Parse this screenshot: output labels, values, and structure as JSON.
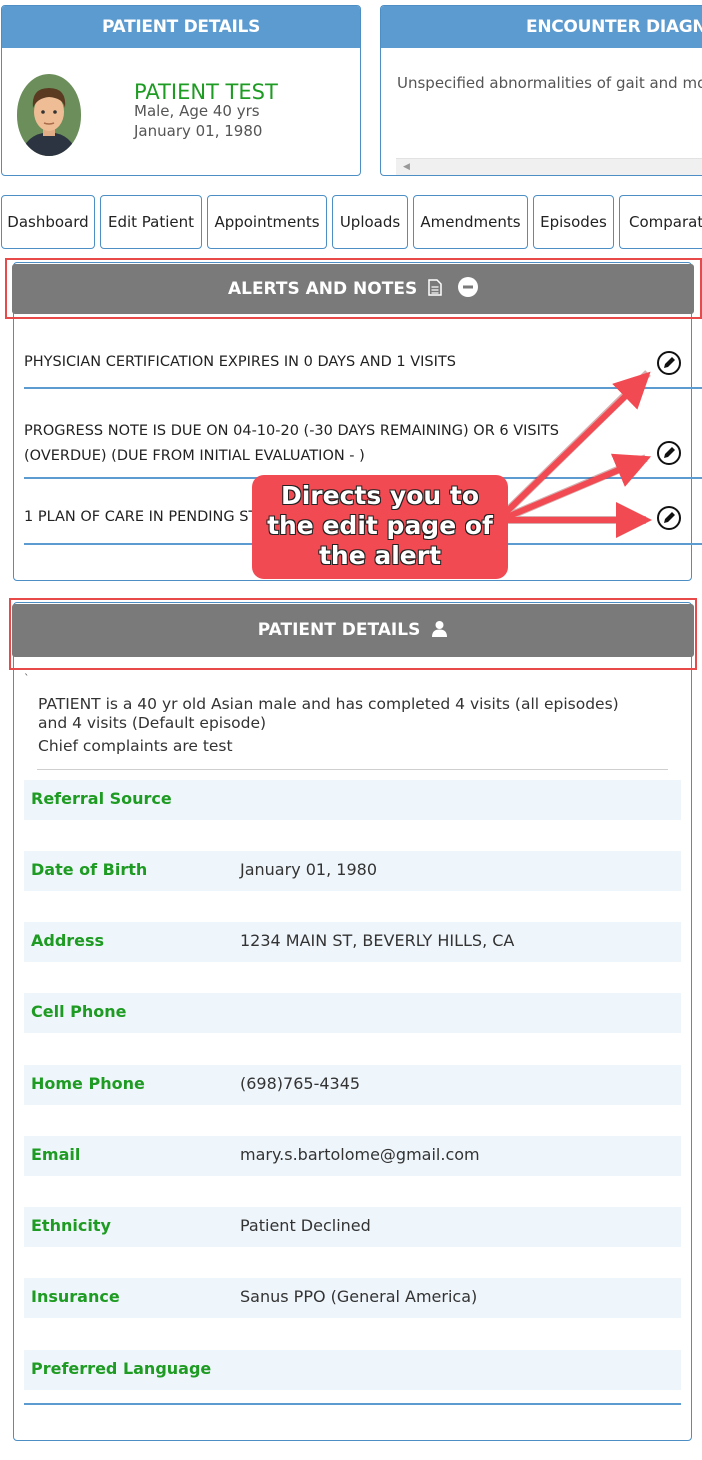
{
  "patient_card": {
    "title": "PATIENT DETAILS",
    "name": "PATIENT TEST",
    "sex_age": "Male, Age 40 yrs",
    "dob": "January 01, 1980"
  },
  "diagnosis_card": {
    "title": "ENCOUNTER DIAGNOSIS",
    "text": "Unspecified abnormalities of gait and mobility"
  },
  "tabs": [
    "Dashboard",
    "Edit Patient",
    "Appointments",
    "Uploads",
    "Amendments",
    "Episodes",
    "Comparator"
  ],
  "alerts": {
    "title": "ALERTS AND NOTES",
    "items": [
      {
        "line1": "PHYSICIAN CERTIFICATION EXPIRES IN 0 DAYS AND 1 VISITS",
        "line2": ""
      },
      {
        "line1": "PROGRESS NOTE IS DUE ON 04-10-20 (-30 DAYS REMAINING) OR 6 VISITS",
        "line2": "(OVERDUE) (DUE FROM INITIAL EVALUATION - )"
      },
      {
        "line1": "1 PLAN OF CARE IN PENDING STATE",
        "line2": ""
      }
    ]
  },
  "callout": {
    "line1": "Directs you to",
    "line2": "the edit page of",
    "line3": "the alert"
  },
  "details": {
    "title": "PATIENT DETAILS",
    "dot": "`",
    "summary1": "PATIENT is a 40 yr old Asian male and has completed 4 visits (all episodes)",
    "summary2": "and 4 visits (Default episode)",
    "summary3": "Chief complaints are test",
    "rows": [
      {
        "label": "Referral Source",
        "value": ""
      },
      {
        "label": "Date of Birth",
        "value": "January 01, 1980"
      },
      {
        "label": "Address",
        "value": "1234 MAIN ST, BEVERLY HILLS, CA"
      },
      {
        "label": "Cell Phone",
        "value": ""
      },
      {
        "label": "Home Phone",
        "value": "(698)765-4345"
      },
      {
        "label": "Email",
        "value": "mary.s.bartolome@gmail.com"
      },
      {
        "label": "Ethnicity",
        "value": "Patient Declined"
      },
      {
        "label": "Insurance",
        "value": "Sanus PPO (General America)"
      },
      {
        "label": "Preferred Language",
        "value": ""
      }
    ]
  },
  "colors": {
    "header_blue": "#5b9bd0",
    "green_text": "#1e9b22",
    "gray_header": "#7a7a7a",
    "annotation_red": "#f24a52"
  }
}
